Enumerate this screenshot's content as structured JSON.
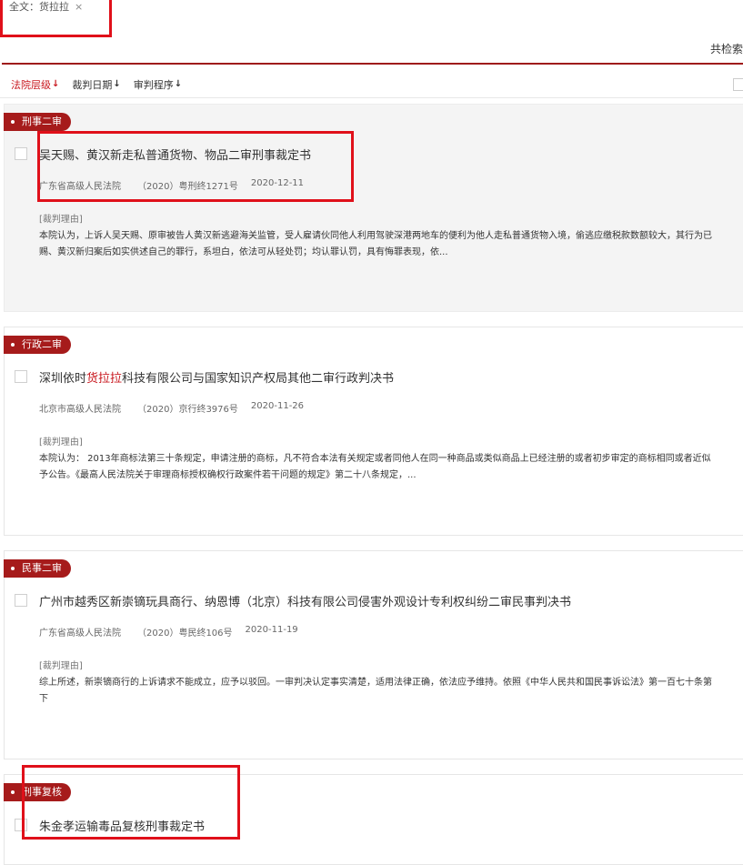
{
  "filter": {
    "tag": "全文：货拉拉",
    "close": "×"
  },
  "total": "共检索",
  "sort": {
    "court_level": "法院层级",
    "judge_date": "裁判日期",
    "procedure": "审判程序",
    "arrow_red": "↓",
    "arrow_black": "↓"
  },
  "results": [
    {
      "badge": "刑事二审",
      "title_pre": "吴天赐、黄汉新走私普通货物、物品二审刑事裁定书",
      "title_hit": "",
      "title_post": "",
      "court": "广东省高级人民法院",
      "case_no": "（2020）粤刑终1271号",
      "date": "2020-12-11",
      "reason_label": "[裁判理由]",
      "excerpt_1": "本院认为，上诉人吴天赐、原审被告人黄汉新逃避海关监管，受人雇请伙同他人利用驾驶深港两地车的便利为他人走私普通货物入境，偷逃应缴税款数额较大，其行为已",
      "excerpt_2": "赐、黄汉新归案后如实供述自己的罪行，系坦白，依法可从轻处罚；均认罪认罚，具有悔罪表现，依..."
    },
    {
      "badge": "行政二审",
      "title_pre": "深圳依时",
      "title_hit": "货拉拉",
      "title_post": "科技有限公司与国家知识产权局其他二审行政判决书",
      "court": "北京市高级人民法院",
      "case_no": "（2020）京行终3976号",
      "date": "2020-11-26",
      "reason_label": "[裁判理由]",
      "excerpt_1": "本院认为： 2013年商标法第三十条规定，申请注册的商标，凡不符合本法有关规定或者同他人在同一种商品或类似商品上已经注册的或者初步审定的商标相同或者近似",
      "excerpt_2": "予公告。《最高人民法院关于审理商标授权确权行政案件若干问题的规定》第二十八条规定，..."
    },
    {
      "badge": "民事二审",
      "title_pre": "广州市越秀区新崇镝玩具商行、纳恩博（北京）科技有限公司侵害外观设计专利权纠纷二审民事判决书",
      "title_hit": "",
      "title_post": "",
      "court": "广东省高级人民法院",
      "case_no": "（2020）粤民终106号",
      "date": "2020-11-19",
      "reason_label": "[裁判理由]",
      "excerpt_1": "综上所述，新崇镝商行的上诉请求不能成立，应予以驳回。一审判决认定事实清楚，适用法律正确，依法应予维持。依照《中华人民共和国民事诉讼法》第一百七十条第",
      "excerpt_2": "下"
    },
    {
      "badge": "刑事复核",
      "title_pre": "朱金孝运输毒品复核刑事裁定书",
      "title_hit": "",
      "title_post": ""
    }
  ]
}
